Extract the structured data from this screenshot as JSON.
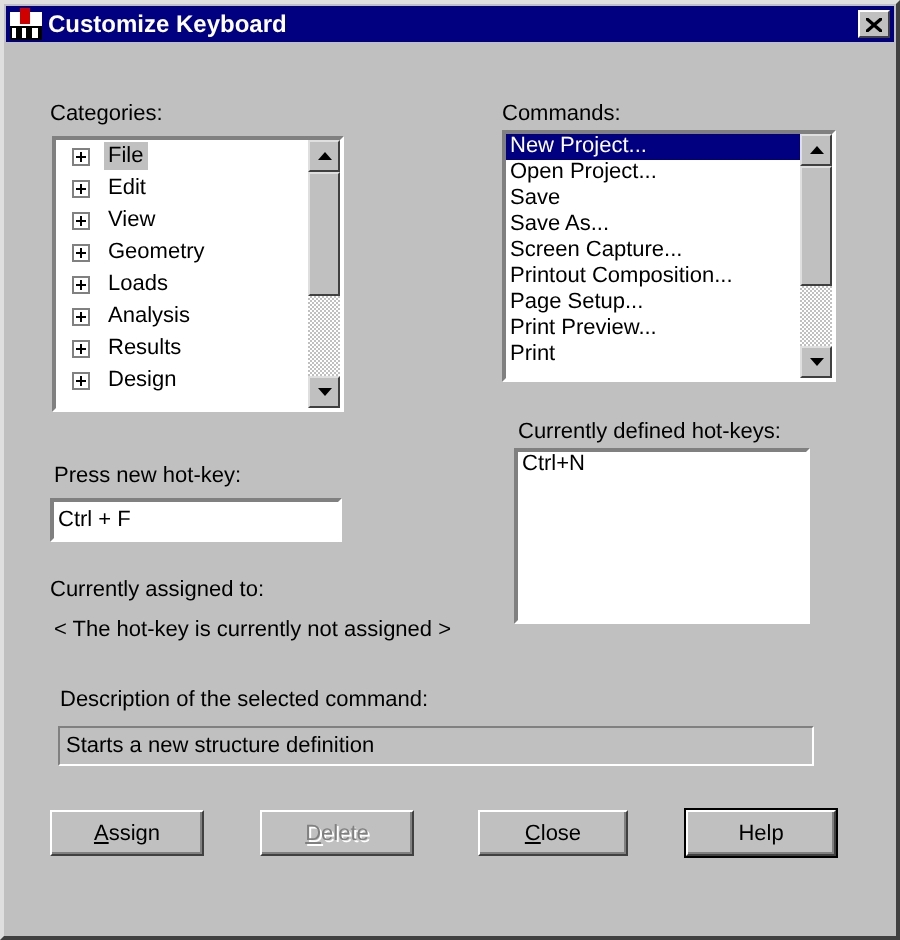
{
  "window": {
    "title": "Customize Keyboard"
  },
  "categories": {
    "label": "Categories:",
    "items": [
      {
        "label": "File",
        "selected": true,
        "expanded": false
      },
      {
        "label": "Edit",
        "selected": false,
        "expanded": false
      },
      {
        "label": "View",
        "selected": false,
        "expanded": false
      },
      {
        "label": "Geometry",
        "selected": false,
        "expanded": false
      },
      {
        "label": "Loads",
        "selected": false,
        "expanded": false
      },
      {
        "label": "Analysis",
        "selected": false,
        "expanded": false
      },
      {
        "label": "Results",
        "selected": false,
        "expanded": false
      },
      {
        "label": "Design",
        "selected": false,
        "expanded": false
      }
    ]
  },
  "commands": {
    "label": "Commands:",
    "items": [
      {
        "label": "New Project...",
        "selected": true
      },
      {
        "label": "Open Project...",
        "selected": false
      },
      {
        "label": "Save",
        "selected": false
      },
      {
        "label": "Save As...",
        "selected": false
      },
      {
        "label": "Screen Capture...",
        "selected": false
      },
      {
        "label": "Printout Composition...",
        "selected": false
      },
      {
        "label": "Page Setup...",
        "selected": false
      },
      {
        "label": "Print Preview...",
        "selected": false
      },
      {
        "label": "Print",
        "selected": false
      }
    ]
  },
  "new_hotkey": {
    "label": "Press new hot-key:",
    "value": "Ctrl + F"
  },
  "assigned": {
    "label": "Currently assigned to:",
    "value": "< The hot-key is currently not assigned >"
  },
  "defined_hotkeys": {
    "label": "Currently defined hot-keys:",
    "items": [
      "Ctrl+N"
    ]
  },
  "description": {
    "label": "Description of the selected command:",
    "value": "Starts a new structure definition"
  },
  "buttons": [
    {
      "label": "Assign",
      "disabled": false,
      "default": false,
      "access_key_first": true
    },
    {
      "label": "Delete",
      "disabled": true,
      "default": false,
      "access_key_first": true
    },
    {
      "label": "Close",
      "disabled": false,
      "default": false,
      "access_key_first": true
    },
    {
      "label": "Help",
      "disabled": false,
      "default": true,
      "access_key_first": false
    }
  ]
}
